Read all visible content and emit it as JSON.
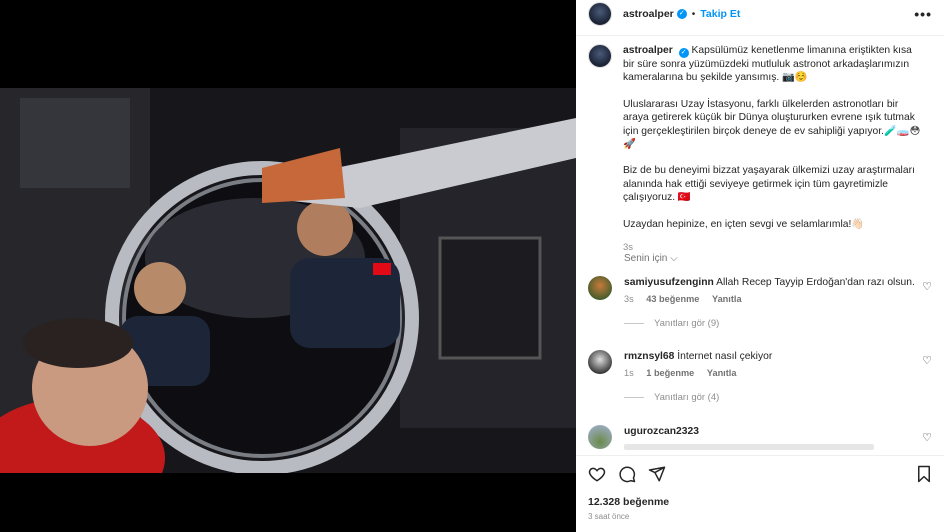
{
  "post": {
    "username": "astroalper",
    "follow_label": "Takip Et",
    "more_label": "•••"
  },
  "caption": {
    "username": "astroalper",
    "p1": "Kapsülümüz kenetlenme limanına eriştikten kısa bir süre sonra yüzümüzdeki mutluluk astronot arkadaşlarımızın kameralarına bu şekilde yansımış. 📷☺️",
    "p2": "Uluslararası Uzay İstasyonu, farklı ülkelerden astronotları bir araya getirerek küçük bir Dünya oluştururken evrene ışık tutmak için gerçekleştirilen birçok deneye de ev sahipliği yapıyor.🧪🧫😳🚀",
    "p3": "Biz de bu deneyimi bizzat yaşayarak ülkemizi uzay araştırmaları alanında hak ettiği seviyeye getirmek için tüm gayretimizle çalışıyoruz. 🇹🇷",
    "p4": "Uzaydan hepinize, en içten sevgi ve selamlarımla!👋🏻",
    "time": "3s"
  },
  "see_translation": "Senin için ⌵",
  "comments": [
    {
      "username": "samiyusufzenginn",
      "text": "Allah Recep Tayyip Erdoğan'dan razı olsun.",
      "time": "3s",
      "likes": "43 beğenme",
      "reply": "Yanıtla",
      "view_replies": "Yanıtları gör (9)"
    },
    {
      "username": "rmznsyl68",
      "text": "İnternet nasıl çekiyor",
      "time": "1s",
      "likes": "1 beğenme",
      "reply": "Yanıtla",
      "view_replies": "Yanıtları gör (4)"
    },
    {
      "username": "ugurozcan2323",
      "text": ""
    }
  ],
  "footer": {
    "likes": "12.328 beğenme",
    "ago": "3 saat önce"
  },
  "icons": [
    "heart-icon",
    "comment-icon",
    "share-icon",
    "bookmark-icon",
    "more-icon",
    "verified-icon"
  ],
  "colors": {
    "accent": "#0095f6",
    "muted": "#8e8e8e"
  }
}
